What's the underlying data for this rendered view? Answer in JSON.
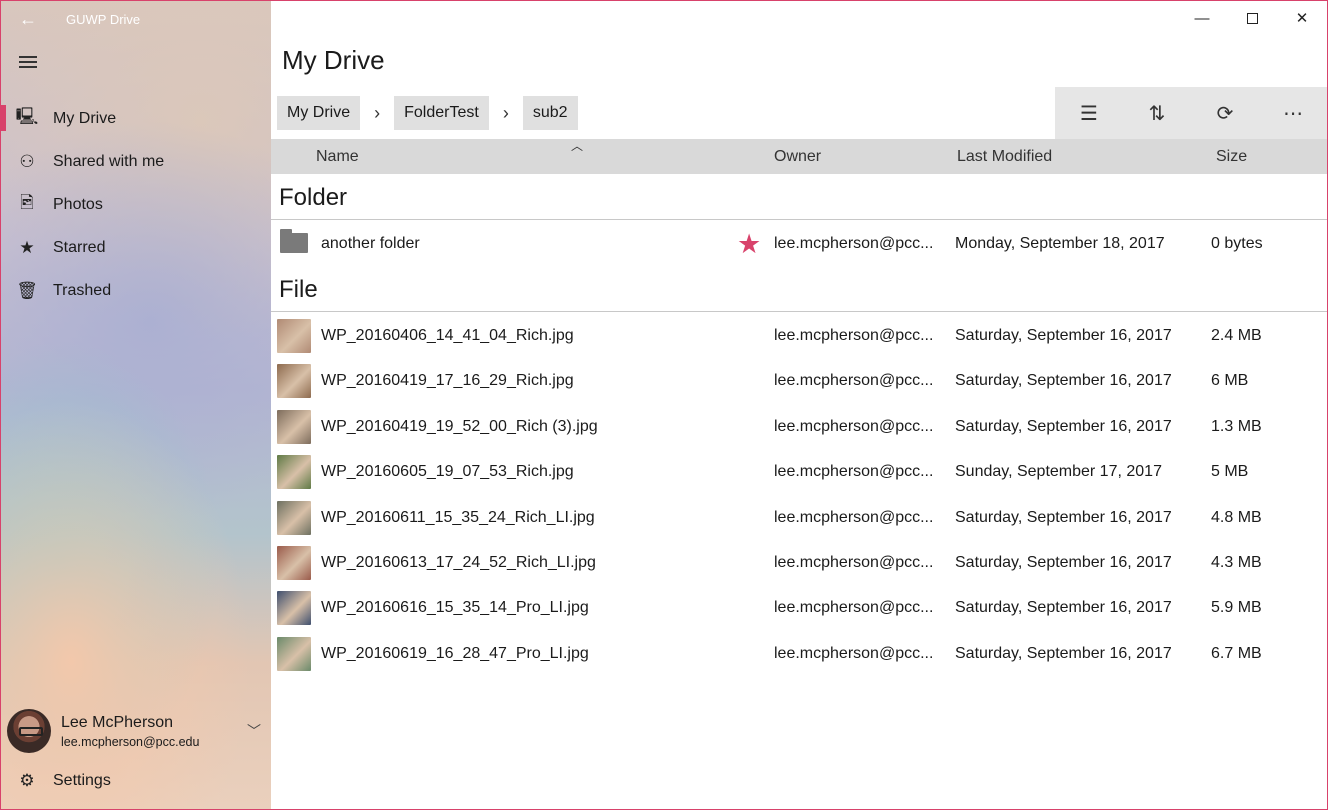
{
  "app": {
    "title": "GUWP Drive",
    "back_icon": "←",
    "accent": "#d8426b"
  },
  "sidebar": {
    "items": [
      {
        "label": "My Drive",
        "icon": "🖳",
        "icon_name": "my-drive-icon",
        "active": true
      },
      {
        "label": "Shared with me",
        "icon": "⚇",
        "icon_name": "shared-icon",
        "active": false
      },
      {
        "label": "Photos",
        "icon": "🖻",
        "icon_name": "photos-icon",
        "active": false
      },
      {
        "label": "Starred",
        "icon": "★",
        "icon_name": "star-icon",
        "active": false
      },
      {
        "label": "Trashed",
        "icon": "🗑",
        "icon_name": "trash-icon",
        "active": false
      }
    ],
    "profile": {
      "name": "Lee McPherson",
      "email": "lee.mcpherson@pcc.edu",
      "chevron": "﹀"
    },
    "settings": {
      "label": "Settings",
      "icon": "⚙"
    }
  },
  "window_controls": {
    "minimize": "—",
    "close": "✕"
  },
  "main": {
    "page_title": "My Drive",
    "breadcrumb": [
      "My Drive",
      "FolderTest",
      "sub2"
    ],
    "breadcrumb_sep": "›",
    "toolbar": {
      "select": "☰",
      "sort": "⇅",
      "refresh": "⟳",
      "more": "⋯"
    },
    "columns": {
      "name": "Name",
      "owner": "Owner",
      "modified": "Last Modified",
      "size": "Size",
      "sort_caret": "︿"
    },
    "groups": [
      {
        "title": "Folder"
      },
      {
        "title": "File"
      }
    ],
    "folders": [
      {
        "name": "another folder",
        "owner": "lee.mcpherson@pcc...",
        "modified": "Monday, September 18, 2017",
        "size": "0 bytes",
        "starred": true
      }
    ],
    "files": [
      {
        "name": "WP_20160406_14_41_04_Rich.jpg",
        "owner": "lee.mcpherson@pcc...",
        "modified": "Saturday, September 16, 2017",
        "size": "2.4 MB",
        "thumb": "#b08a74"
      },
      {
        "name": "WP_20160419_17_16_29_Rich.jpg",
        "owner": "lee.mcpherson@pcc...",
        "modified": "Saturday, September 16, 2017",
        "size": "6 MB",
        "thumb": "#8d6a4e"
      },
      {
        "name": "WP_20160419_19_52_00_Rich (3).jpg",
        "owner": "lee.mcpherson@pcc...",
        "modified": "Saturday, September 16, 2017",
        "size": "1.3 MB",
        "thumb": "#7d6c5c"
      },
      {
        "name": "WP_20160605_19_07_53_Rich.jpg",
        "owner": "lee.mcpherson@pcc...",
        "modified": "Sunday, September 17, 2017",
        "size": "5 MB",
        "thumb": "#5f7a45"
      },
      {
        "name": "WP_20160611_15_35_24_Rich_LI.jpg",
        "owner": "lee.mcpherson@pcc...",
        "modified": "Saturday, September 16, 2017",
        "size": "4.8 MB",
        "thumb": "#6d7060"
      },
      {
        "name": "WP_20160613_17_24_52_Rich_LI.jpg",
        "owner": "lee.mcpherson@pcc...",
        "modified": "Saturday, September 16, 2017",
        "size": "4.3 MB",
        "thumb": "#9a5a4a"
      },
      {
        "name": "WP_20160616_15_35_14_Pro_LI.jpg",
        "owner": "lee.mcpherson@pcc...",
        "modified": "Saturday, September 16, 2017",
        "size": "5.9 MB",
        "thumb": "#3f4f6e"
      },
      {
        "name": "WP_20160619_16_28_47_Pro_LI.jpg",
        "owner": "lee.mcpherson@pcc...",
        "modified": "Saturday, September 16, 2017",
        "size": "6.7 MB",
        "thumb": "#6a8a6a"
      }
    ]
  }
}
